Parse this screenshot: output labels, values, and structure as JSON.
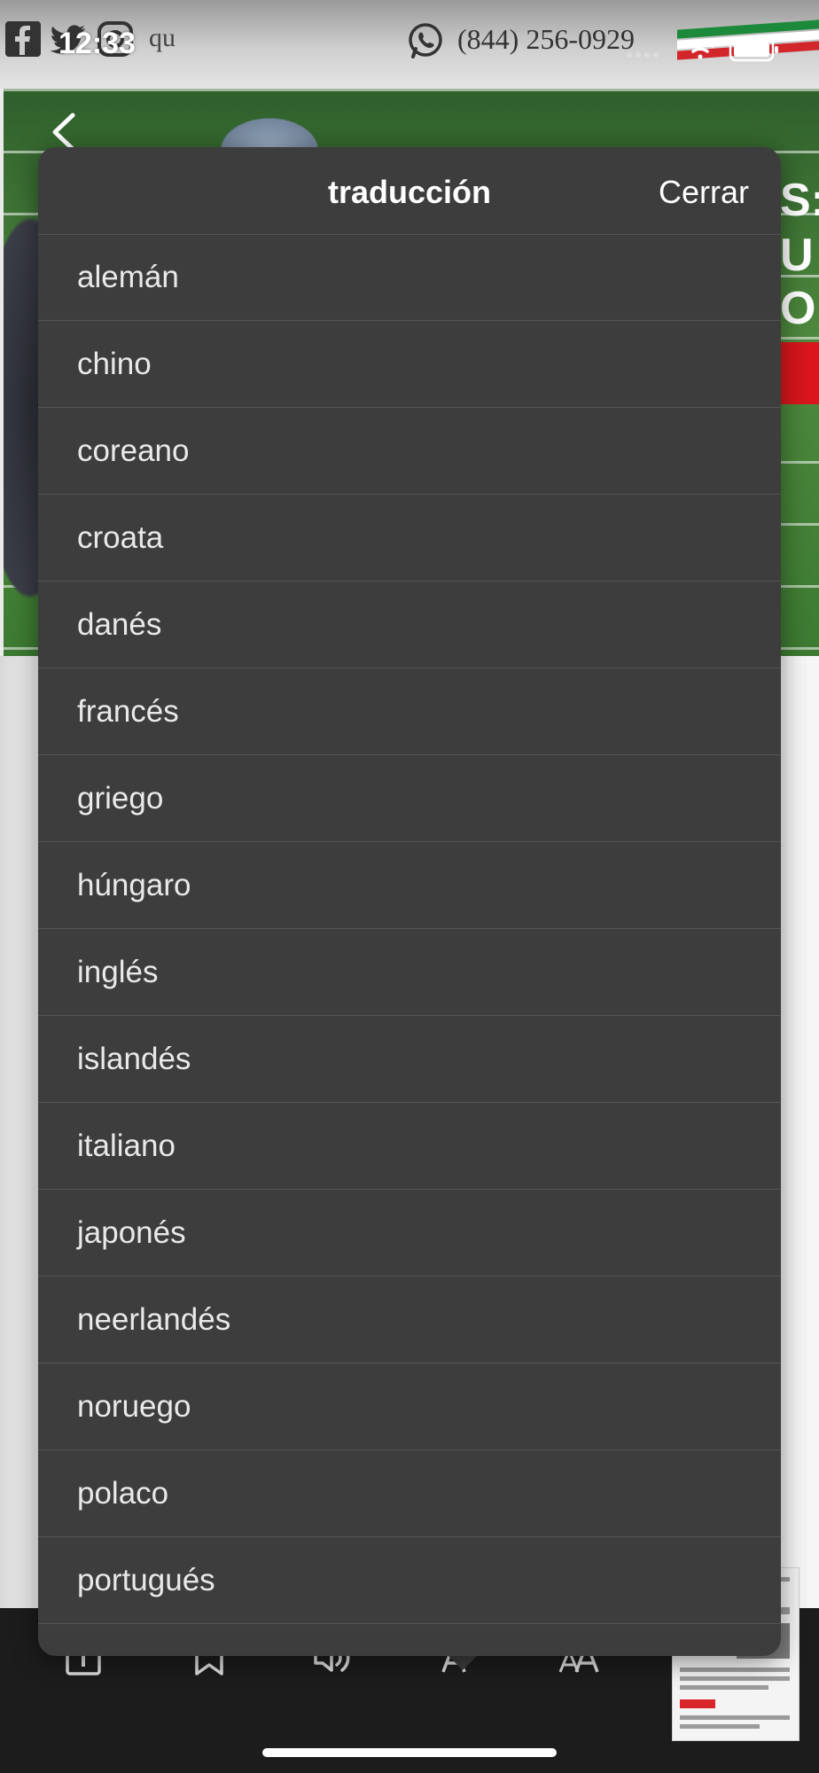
{
  "status_bar": {
    "time": "12:33"
  },
  "site_header": {
    "url_fragment": "qu",
    "phone": "(844) 256-0929",
    "icons": [
      "facebook-icon",
      "twitter-icon",
      "instagram-icon",
      "whatsapp-icon"
    ]
  },
  "hero": {
    "text_fragments": [
      "S:",
      "U",
      "O"
    ]
  },
  "popover": {
    "title": "traducción",
    "close_label": "Cerrar",
    "languages": [
      "alemán",
      "chino",
      "coreano",
      "croata",
      "danés",
      "francés",
      "griego",
      "húngaro",
      "inglés",
      "islandés",
      "italiano",
      "japonés",
      "neerlandés",
      "noruego",
      "polaco",
      "portugués"
    ]
  },
  "toolbar": {
    "icons": [
      "info-icon",
      "bookmark-icon",
      "audio-icon",
      "translate-icon",
      "font-size-icon"
    ]
  },
  "colors": {
    "popover_bg": "#3d3d3d",
    "separator": "#555555",
    "toolbar_bg": "#1c1c1c"
  }
}
